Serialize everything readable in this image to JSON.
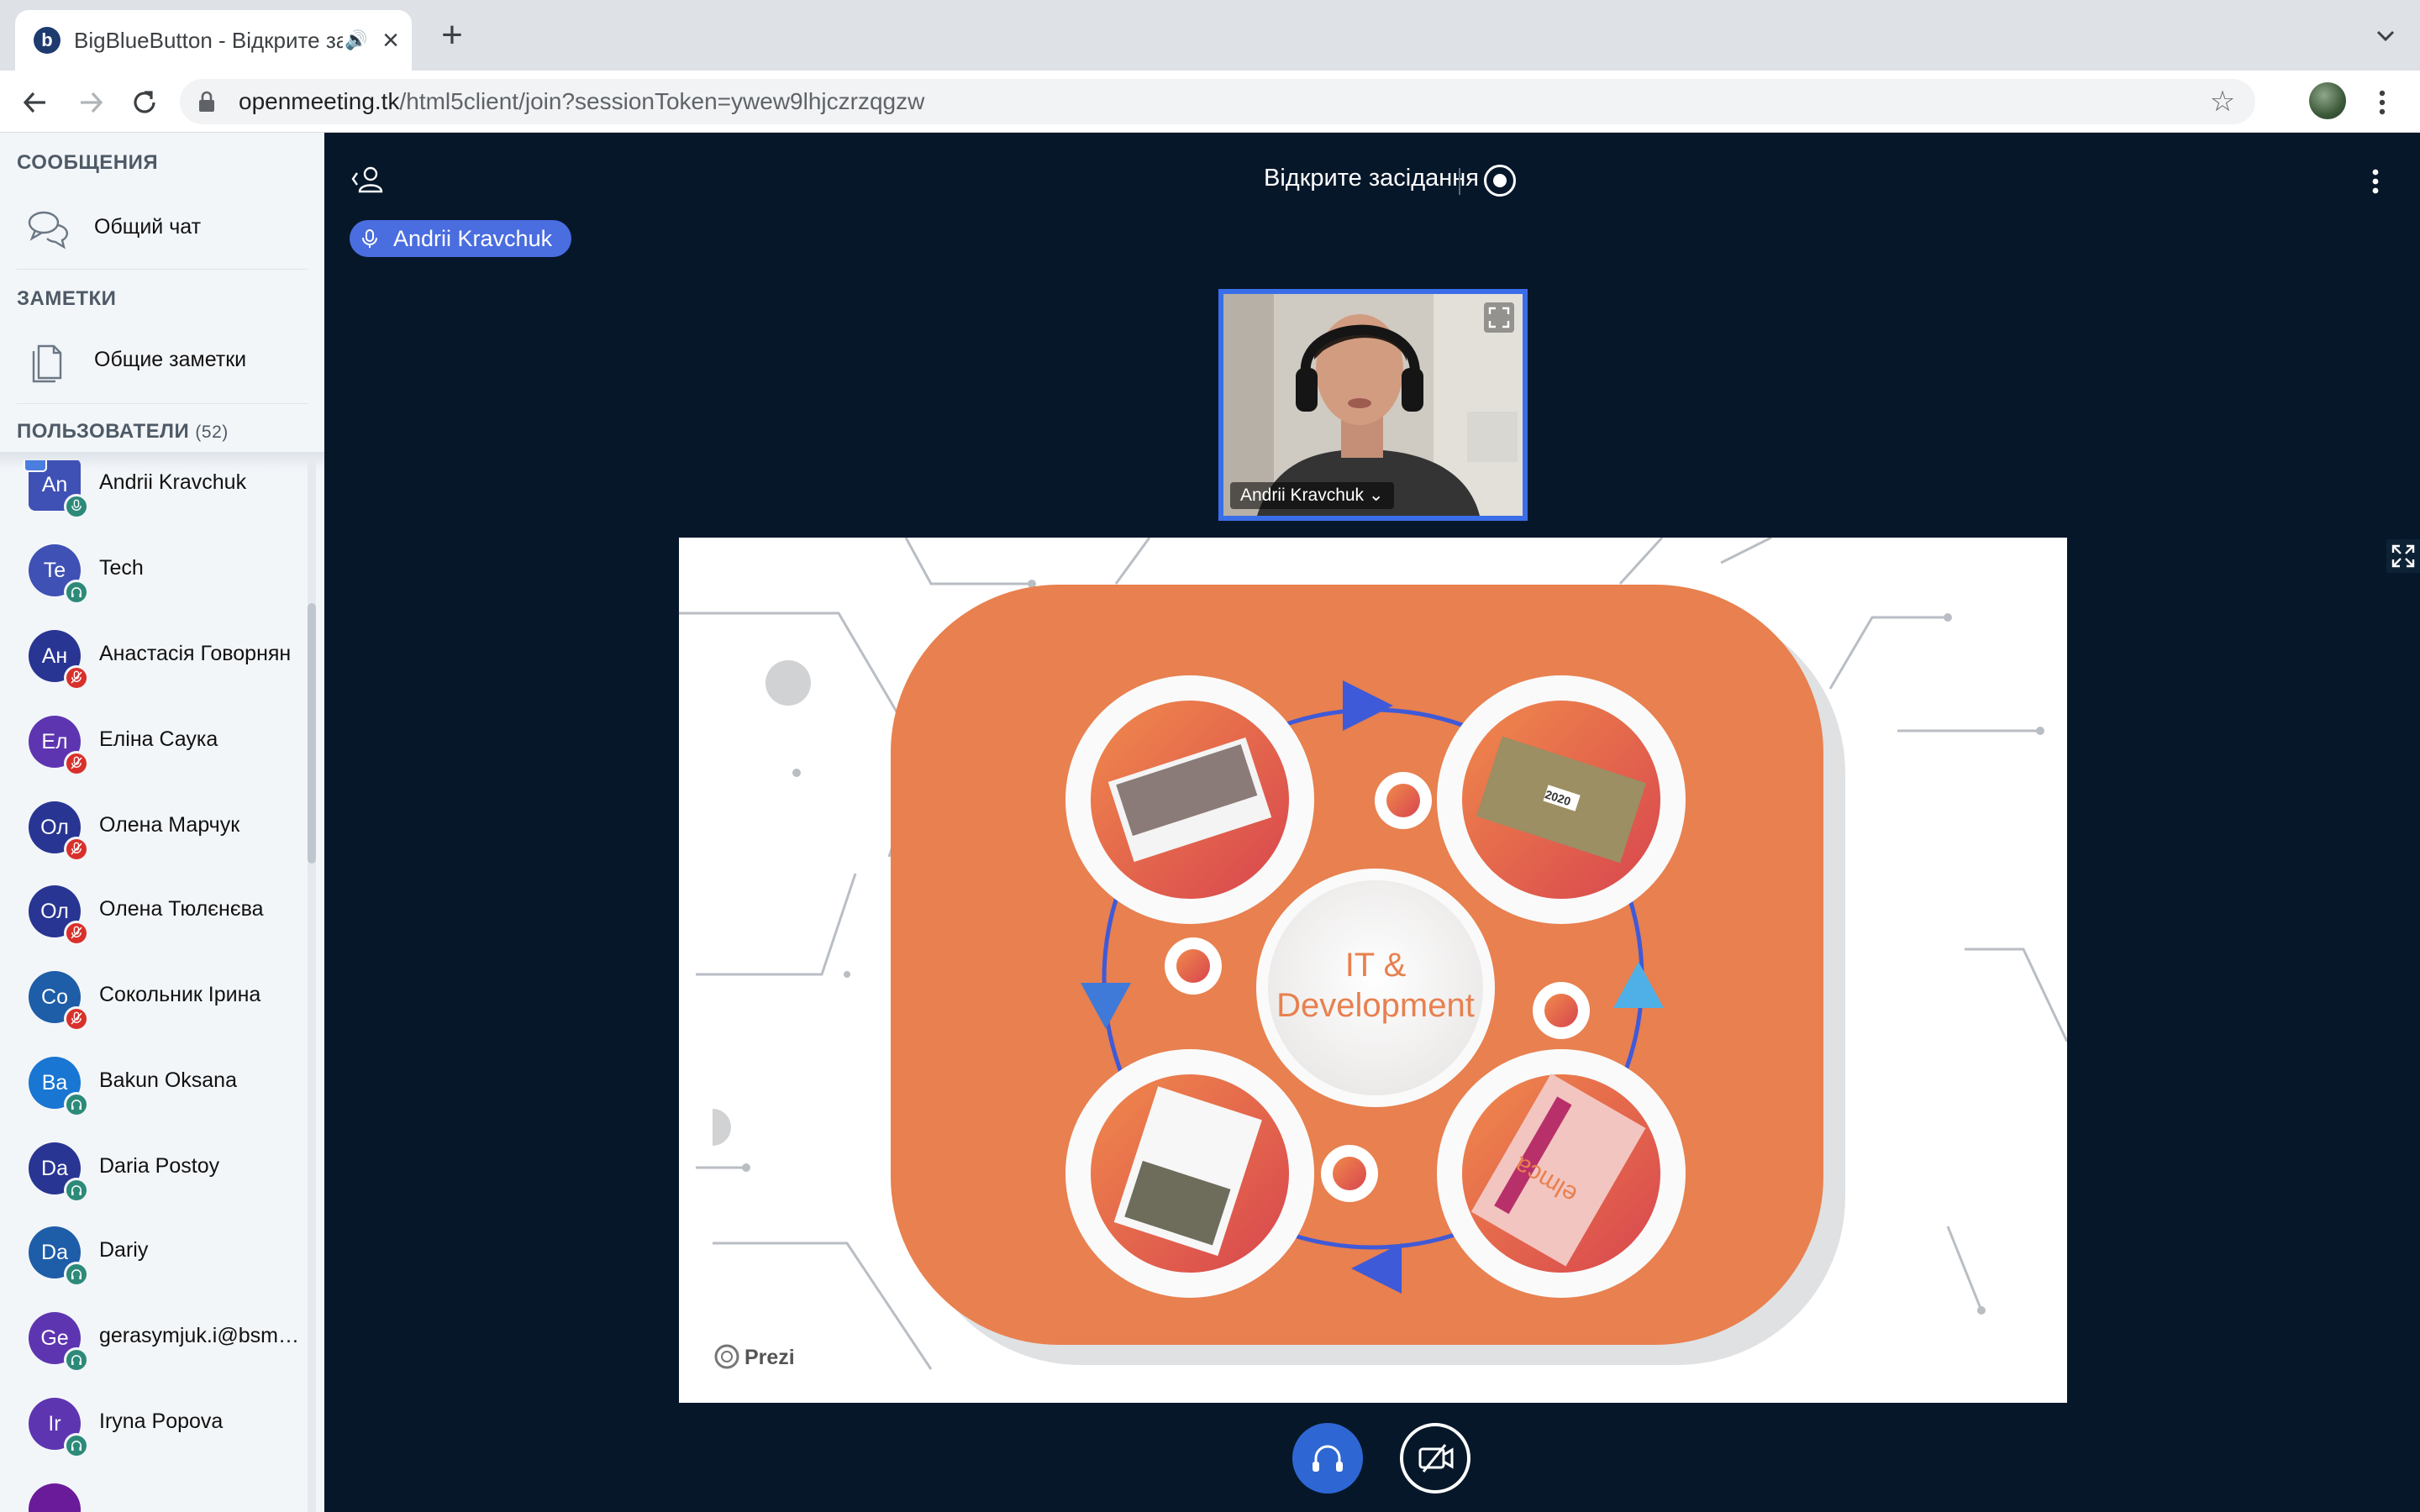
{
  "browser": {
    "tab_title": "BigBlueButton - Відкрите засідання",
    "url_domain": "openmeeting.tk",
    "url_path": "/html5client/join?sessionToken=ywew9lhjczrzqgzw"
  },
  "sidebar": {
    "messages_title": "СООБЩЕНИЯ",
    "public_chat": "Общий чат",
    "notes_title": "ЗАМЕТКИ",
    "shared_notes": "Общие заметки",
    "users_title": "ПОЛЬЗОВАТЕЛИ",
    "users_count": "(52)",
    "users": [
      {
        "initials": "An",
        "name": "Andrii Kravchuk",
        "color": "#3f51b5",
        "status": "mic-on",
        "presenter": true
      },
      {
        "initials": "Te",
        "name": "Tech",
        "color": "#3f51b5",
        "status": "listen-only"
      },
      {
        "initials": "Ан",
        "name": "Анастасія Говорнян",
        "color": "#283593",
        "status": "muted"
      },
      {
        "initials": "Ел",
        "name": "Еліна Саука",
        "color": "#5e35b1",
        "status": "muted"
      },
      {
        "initials": "Ол",
        "name": "Олена Марчук",
        "color": "#283593",
        "status": "muted"
      },
      {
        "initials": "Ол",
        "name": "Олена Тюлєнєва",
        "color": "#283593",
        "status": "muted"
      },
      {
        "initials": "Со",
        "name": "Сокольник Ірина",
        "color": "#1e5da8",
        "status": "muted"
      },
      {
        "initials": "Ba",
        "name": "Bakun Oksana",
        "color": "#1976d2",
        "status": "listen-only"
      },
      {
        "initials": "Da",
        "name": "Daria Postoy",
        "color": "#283593",
        "status": "listen-only"
      },
      {
        "initials": "Da",
        "name": "Dariy",
        "color": "#1e5da8",
        "status": "listen-only"
      },
      {
        "initials": "Ge",
        "name": "gerasymjuk.i@bsmu.edu.ua",
        "color": "#5e35b1",
        "status": "listen-only"
      },
      {
        "initials": "Ir",
        "name": "Iryna Popova",
        "color": "#5e35b1",
        "status": "listen-only"
      },
      {
        "initials": "",
        "name": "",
        "color": "#6a1b9a",
        "status": "listen-only"
      }
    ]
  },
  "main": {
    "meeting_title": "Відкрите засідання",
    "talking_user": "Andrii Kravchuk",
    "webcam_name": "Andrii Kravchuk ⌄",
    "slide": {
      "center_line1": "IT &",
      "center_line2": "Development",
      "badge_2020": "2020",
      "brand_mark": "Prezi",
      "flyer_text": "elmca"
    }
  },
  "colors": {
    "main_bg": "#06172a",
    "accent": "#3a6ee8",
    "slide_orange": "#e8804f",
    "muted": "#d9302c",
    "listen": "#2d8a79"
  }
}
